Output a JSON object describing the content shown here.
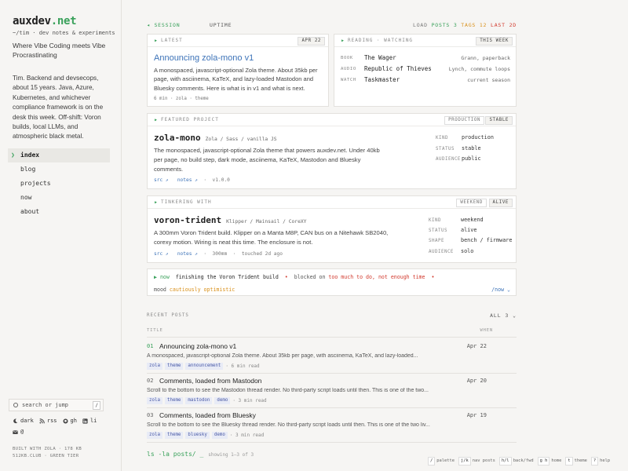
{
  "sidebar": {
    "logo_base": "auxdev",
    "logo_tld": ".net",
    "tagline_mono": "~/tim · dev notes & experiments",
    "tagline": "Where Vibe Coding meets Vibe Procrastinating",
    "bio": "Tim. Backend and devsecops, about 15 years. Java, Azure, Kubernetes, and whichever compliance framework is on the desk this week. Off-shift: Voron builds, local LLMs, and atmospheric black metal.",
    "nav": [
      {
        "label": "index",
        "active": true
      },
      {
        "label": "blog"
      },
      {
        "label": "projects"
      },
      {
        "label": "now"
      },
      {
        "label": "about"
      }
    ],
    "search_placeholder": "search or jump",
    "search_key": "/",
    "links": {
      "dark": "dark",
      "rss": "rss",
      "gh": "gh",
      "li": "li",
      "mail": "@"
    },
    "built_line1": "BUILT WITH ZOLA · 178 KB",
    "built_line2": "512KB.CLUB · GREEN TIER"
  },
  "status": {
    "session": "SESSION",
    "uptime": "UPTIME",
    "load_label": "LOAD",
    "posts": "POSTS 3",
    "tags": "TAGS 12",
    "last": "LAST 2D"
  },
  "latest": {
    "head": "LATEST",
    "date": "APR 22",
    "title": "Announcing zola-mono v1",
    "desc": "A monospaced, javascript-optional Zola theme. About 35kb per page, with asciinema, KaTeX, and lazy-loaded Mastodon and Bluesky comments. Here is what is in v1 and what is next.",
    "meta": "6 min · zola · theme"
  },
  "reading": {
    "head": "READING · WATCHING",
    "tag": "THIS WEEK",
    "rows": [
      {
        "k": "BOOK",
        "t": "The Wager",
        "v": "Grann, paperback"
      },
      {
        "k": "AUDIO",
        "t": "Republic of Thieves",
        "v": "Lynch, commute loops"
      },
      {
        "k": "WATCH",
        "t": "Taskmaster",
        "v": "current season"
      }
    ]
  },
  "featured": {
    "head": "FEATURED PROJECT",
    "tag_soft": "PRODUCTION",
    "tag": "STABLE",
    "name": "zola-mono",
    "stack": "Zola / Sass / vanilla JS",
    "desc": "The monospaced, javascript-optional Zola theme that powers auxdev.net. Under 40kb per page, no build step, dark mode, asciinema, KaTeX, Mastodon and Bluesky comments.",
    "src": "src ↗",
    "notes": "notes ↗",
    "version": "v1.0.0",
    "kv": [
      {
        "k": "KIND",
        "v": "production"
      },
      {
        "k": "STATUS",
        "v": "stable"
      },
      {
        "k": "AUDIENCE",
        "v": "public"
      }
    ]
  },
  "tinkering": {
    "head": "TINKERING WITH",
    "tag_soft": "WEEKEND",
    "tag": "ALIVE",
    "name": "voron-trident",
    "stack": "Klipper / Mainsail / CoreXY",
    "desc": "A 300mm Voron Trident build. Klipper on a Manta M8P, CAN bus on a Nitehawk SB2040, corexy motion. Wiring is neat this time. The enclosure is not.",
    "src": "src ↗",
    "notes": "notes ↗",
    "size": "300mm",
    "touched": "touched 2d ago",
    "kv": [
      {
        "k": "KIND",
        "v": "weekend"
      },
      {
        "k": "STATUS",
        "v": "alive"
      },
      {
        "k": "SHAPE",
        "v": "bench / firmware"
      },
      {
        "k": "AUDIENCE",
        "v": "solo"
      }
    ]
  },
  "now": {
    "label": "now",
    "text": "finishing the Voron Trident build",
    "blocked_label": "blocked on",
    "blocked": "too much to do, not enough time",
    "mood_label": "mood",
    "mood": "cautiously optimistic",
    "link": "/now ⌄"
  },
  "recent": {
    "head": "RECENT POSTS",
    "all": "ALL 3 ⌄",
    "col_title": "TITLE",
    "col_when": "WHEN",
    "posts": [
      {
        "num": "01",
        "title": "Announcing zola-mono v1",
        "date": "Apr 22",
        "desc": "A monospaced, javascript-optional Zola theme. About 35kb per page, with asciinema, KaTeX, and lazy-loaded...",
        "tags": [
          "zola",
          "theme",
          "announcement"
        ],
        "read": "· 6 min read"
      },
      {
        "num": "02",
        "title": "Comments, loaded from Mastodon",
        "date": "Apr 20",
        "desc": "Scroll to the bottom to see the Mastodon thread render. No third-party script loads until then. This is one of the two...",
        "tags": [
          "zola",
          "theme",
          "mastodon",
          "demo"
        ],
        "read": "· 3 min read"
      },
      {
        "num": "03",
        "title": "Comments, loaded from Bluesky",
        "date": "Apr 19",
        "desc": "Scroll to the bottom to see the Bluesky thread render. No third-party script loads until then. This is one of the two liv...",
        "tags": [
          "zola",
          "theme",
          "bluesky",
          "demo"
        ],
        "read": "· 3 min read"
      }
    ],
    "ls": "ls -la posts/",
    "ls_cursor": "_",
    "showing": "showing 1–3 of 3"
  },
  "keys": [
    {
      "k": "/",
      "label": "palette"
    },
    {
      "k": "j/k",
      "label": "nav posts"
    },
    {
      "k": "h/l",
      "label": "back/fwd"
    },
    {
      "k": "g h",
      "label": "home"
    },
    {
      "k": "t",
      "label": "theme"
    },
    {
      "k": "?",
      "label": "help"
    }
  ],
  "colors": {
    "accent_green": "#3aa15b",
    "link_blue": "#3d73b8",
    "warn_orange": "#d9901a",
    "alert_red": "#d23a2e"
  }
}
